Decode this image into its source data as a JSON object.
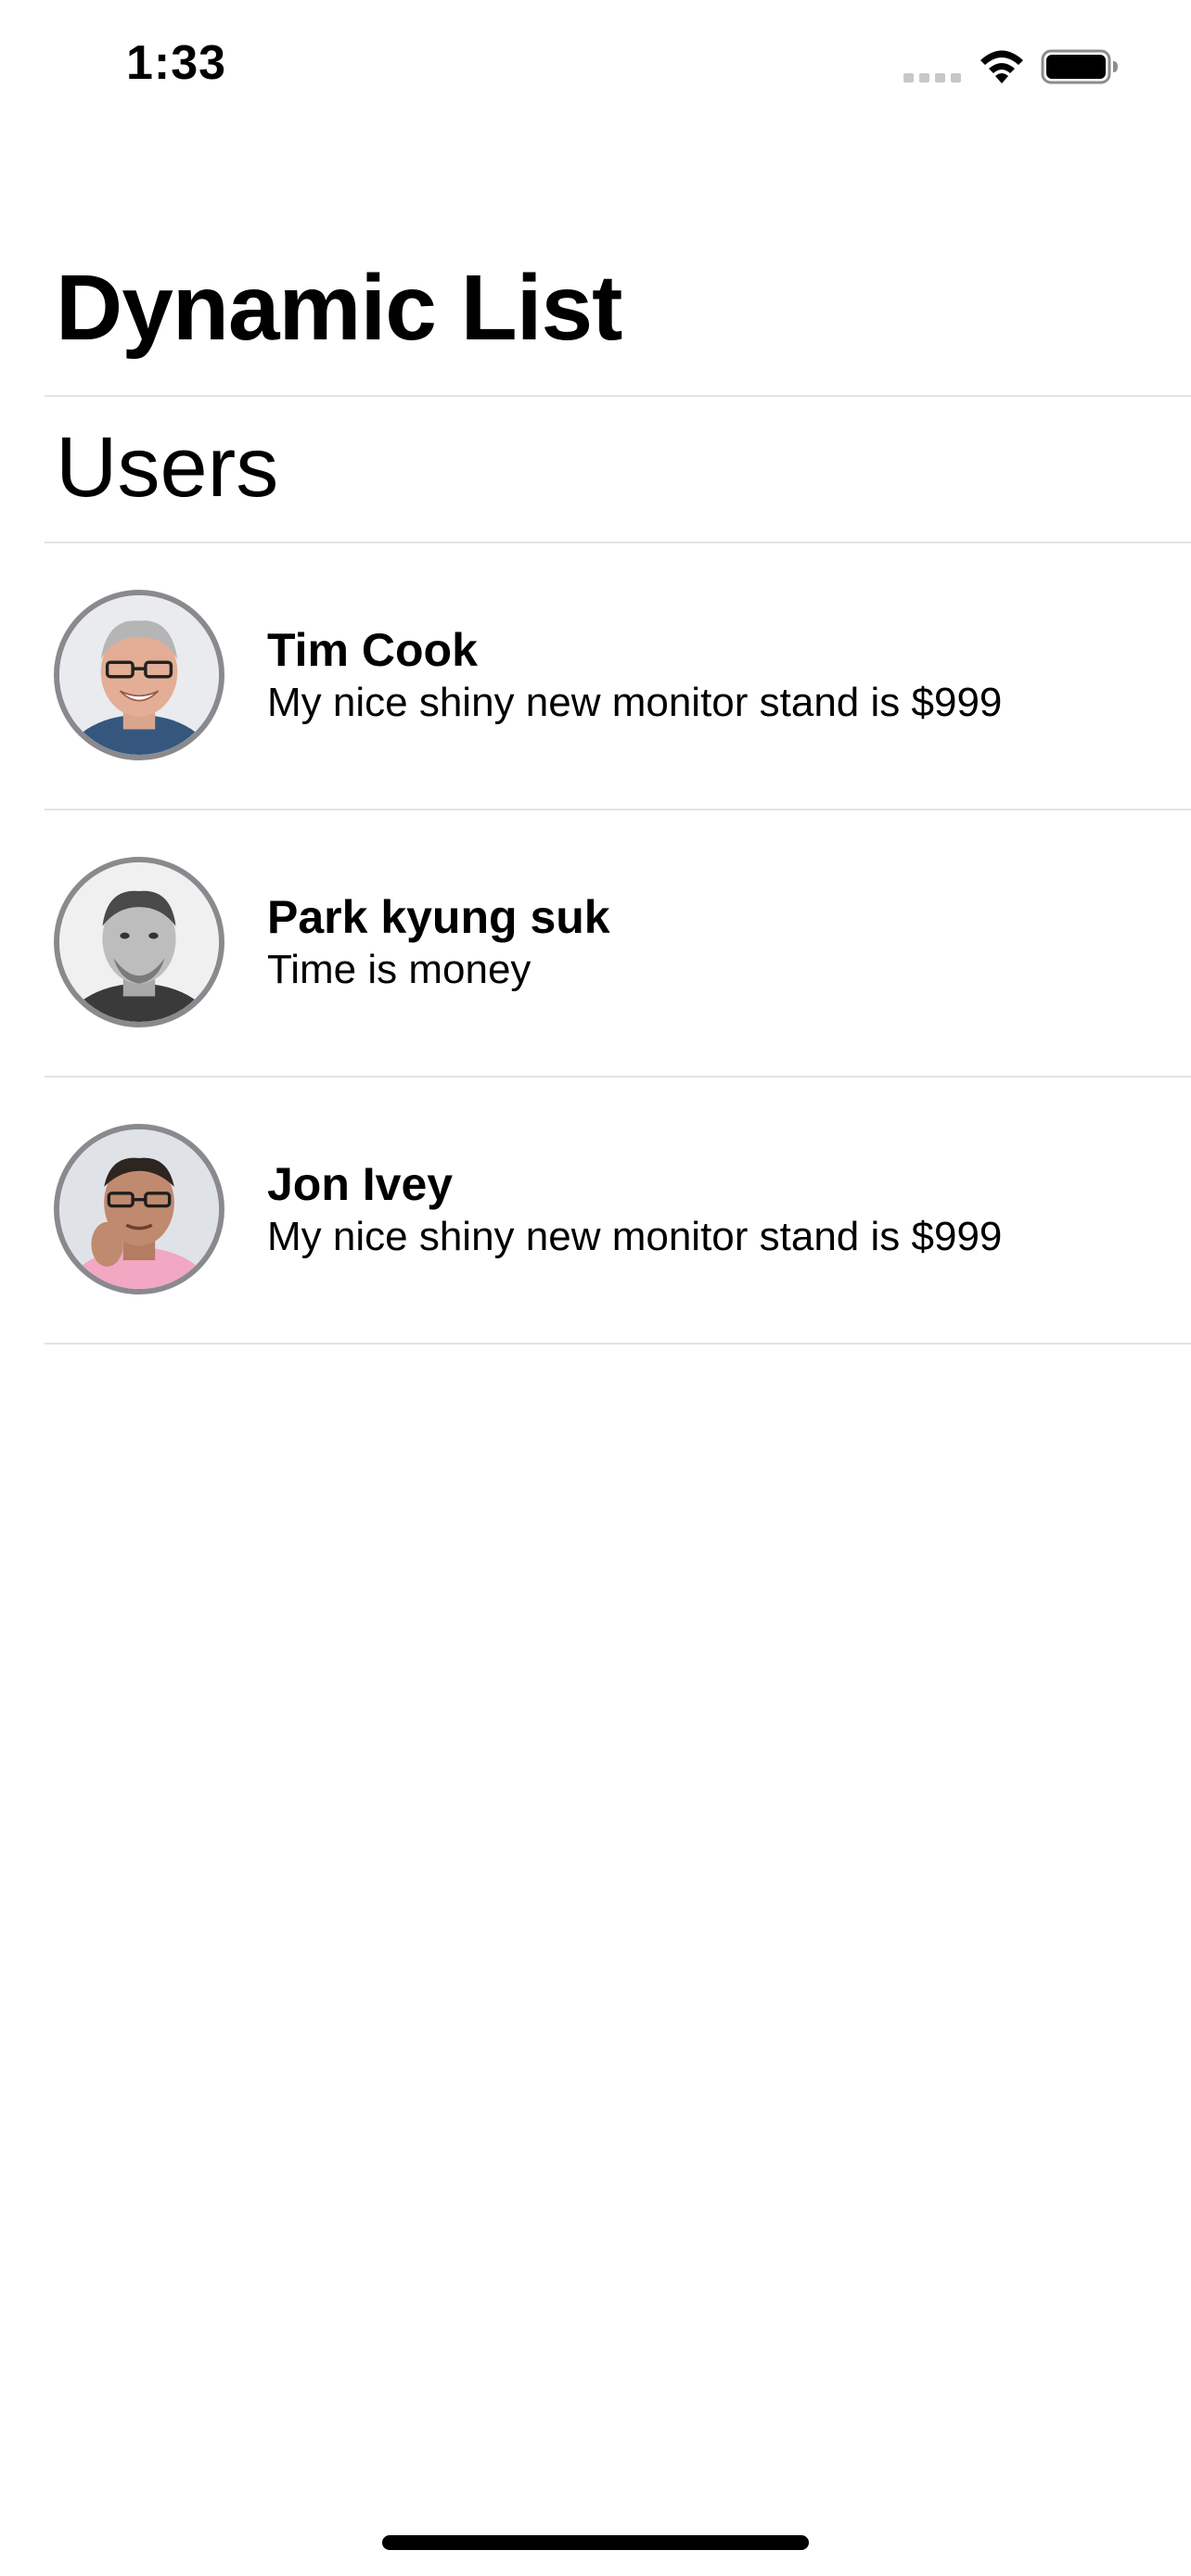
{
  "status_bar": {
    "time": "1:33",
    "signal_icon": "cellular-signal-icon",
    "wifi_icon": "wifi-icon",
    "battery_icon": "battery-full-icon"
  },
  "nav": {
    "title": "Dynamic List"
  },
  "section": {
    "header": "Users"
  },
  "users": [
    {
      "name": "Tim Cook",
      "status": "My nice shiny new monitor stand is $999",
      "avatar_icon": "avatar-photo"
    },
    {
      "name": "Park kyung suk",
      "status": "Time is money",
      "avatar_icon": "avatar-photo"
    },
    {
      "name": "Jon Ivey",
      "status": "My nice shiny new monitor stand is $999",
      "avatar_icon": "avatar-photo"
    }
  ],
  "colors": {
    "divider": "#e3e3e6",
    "avatar_border": "#8a8a8e",
    "signal_inactive": "#c7c7cc"
  }
}
